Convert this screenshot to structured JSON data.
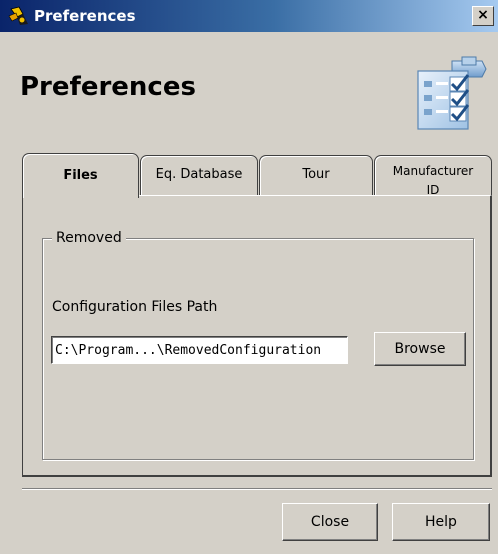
{
  "window": {
    "title": "Preferences",
    "close_glyph": "×",
    "title_icon": "app-icon"
  },
  "header": {
    "title": "Preferences",
    "icon": "preferences-checklist-icon"
  },
  "tabs": [
    {
      "label": "Files",
      "selected": true
    },
    {
      "label": "Eq. Database",
      "selected": false
    },
    {
      "label": "Tour",
      "selected": false
    },
    {
      "label": "Manufacturer ID",
      "line1": "Manufacturer",
      "line2": "ID",
      "selected": false
    }
  ],
  "files_tab": {
    "group_title": "Removed",
    "config_label": "Configuration Files Path",
    "path_value": "C:\\Program...\\RemovedConfiguration",
    "browse_label": "Browse"
  },
  "footer": {
    "close_label": "Close",
    "help_label": "Help"
  },
  "colors": {
    "face": "#d4d0c8",
    "title_gradient_start": "#0a246a",
    "title_gradient_end": "#a6caf0",
    "title_text": "#ffffff"
  }
}
